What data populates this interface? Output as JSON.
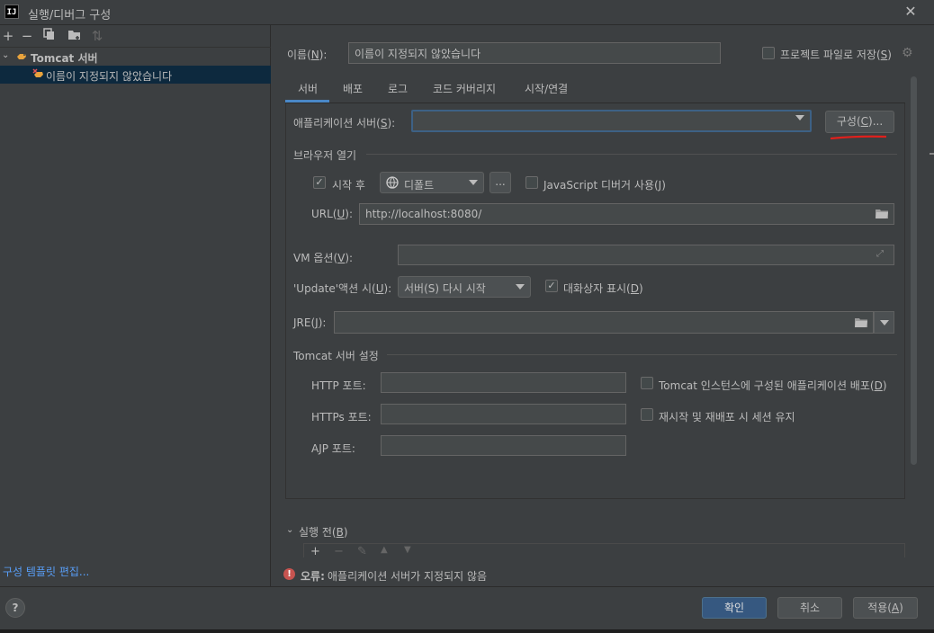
{
  "window": {
    "title": "실행/디버그 구성",
    "logo_text": "IJ",
    "close": "✕"
  },
  "left_toolbar": {
    "add": "+",
    "remove": "−",
    "copy": "⧉",
    "folder": "▸",
    "sort": "⇅"
  },
  "tree": {
    "group_label": "Tomcat 서버",
    "item_label": "이름이 지정되지 않았습니다"
  },
  "edit_templates": "구성 템플릿 편집...",
  "name": {
    "label": "이름(N):",
    "value": "이름이 지정되지 않았습니다"
  },
  "store_as_file": {
    "label": "프로젝트 파일로 저장(S)",
    "checked": false
  },
  "tabs": [
    {
      "label": "서버",
      "active": true
    },
    {
      "label": "배포"
    },
    {
      "label": "로그"
    },
    {
      "label": "코드 커버리지"
    },
    {
      "label": "시작/연결"
    }
  ],
  "server_tab": {
    "app_server_label": "애플리케이션 서버(S):",
    "app_server_value": "",
    "configure_button": "구성(C)...",
    "browser_section": "브라우저 열기",
    "after_launch_label": "시작 후",
    "after_launch_checked": true,
    "browser_value": "디폴트",
    "browse_button": "...",
    "js_debugger_label": "JavaScript 디버거 사용(J)",
    "js_debugger_checked": false,
    "url_label": "URL(U):",
    "url_value": "http://localhost:8080/",
    "vm_label": "VM 옵션(V):",
    "vm_value": "",
    "update_label": "'Update'액션 시(U):",
    "update_value": "서버(S) 다시 시작",
    "dialog_label": "대화상자 표시(D)",
    "dialog_checked": true,
    "jre_label": "JRE(J):",
    "jre_value": "",
    "tomcat_section": "Tomcat 서버 설정",
    "http_port_label": "HTTP 포트:",
    "https_port_label": "HTTPs 포트:",
    "ajp_port_label": "AJP 포트:",
    "deploy_label": "Tomcat 인스턴스에 구성된 애플리케이션 배포(D)",
    "deploy_checked": false,
    "session_label": "재시작 및 재배포 시 세션 유지",
    "session_checked": false
  },
  "before_launch": {
    "label": "실행 전(B)",
    "add": "+",
    "remove": "−",
    "edit": "✎",
    "up": "▲",
    "down": "▼"
  },
  "error": {
    "prefix": "오류:",
    "text": "애플리케이션 서버가 지정되지 않음"
  },
  "buttons": {
    "help": "?",
    "ok": "확인",
    "cancel": "취소",
    "apply": "적용(A)"
  },
  "colors": {
    "accent": "#4a88c7",
    "error": "#c75450",
    "annotation_red": "#e0201c"
  }
}
